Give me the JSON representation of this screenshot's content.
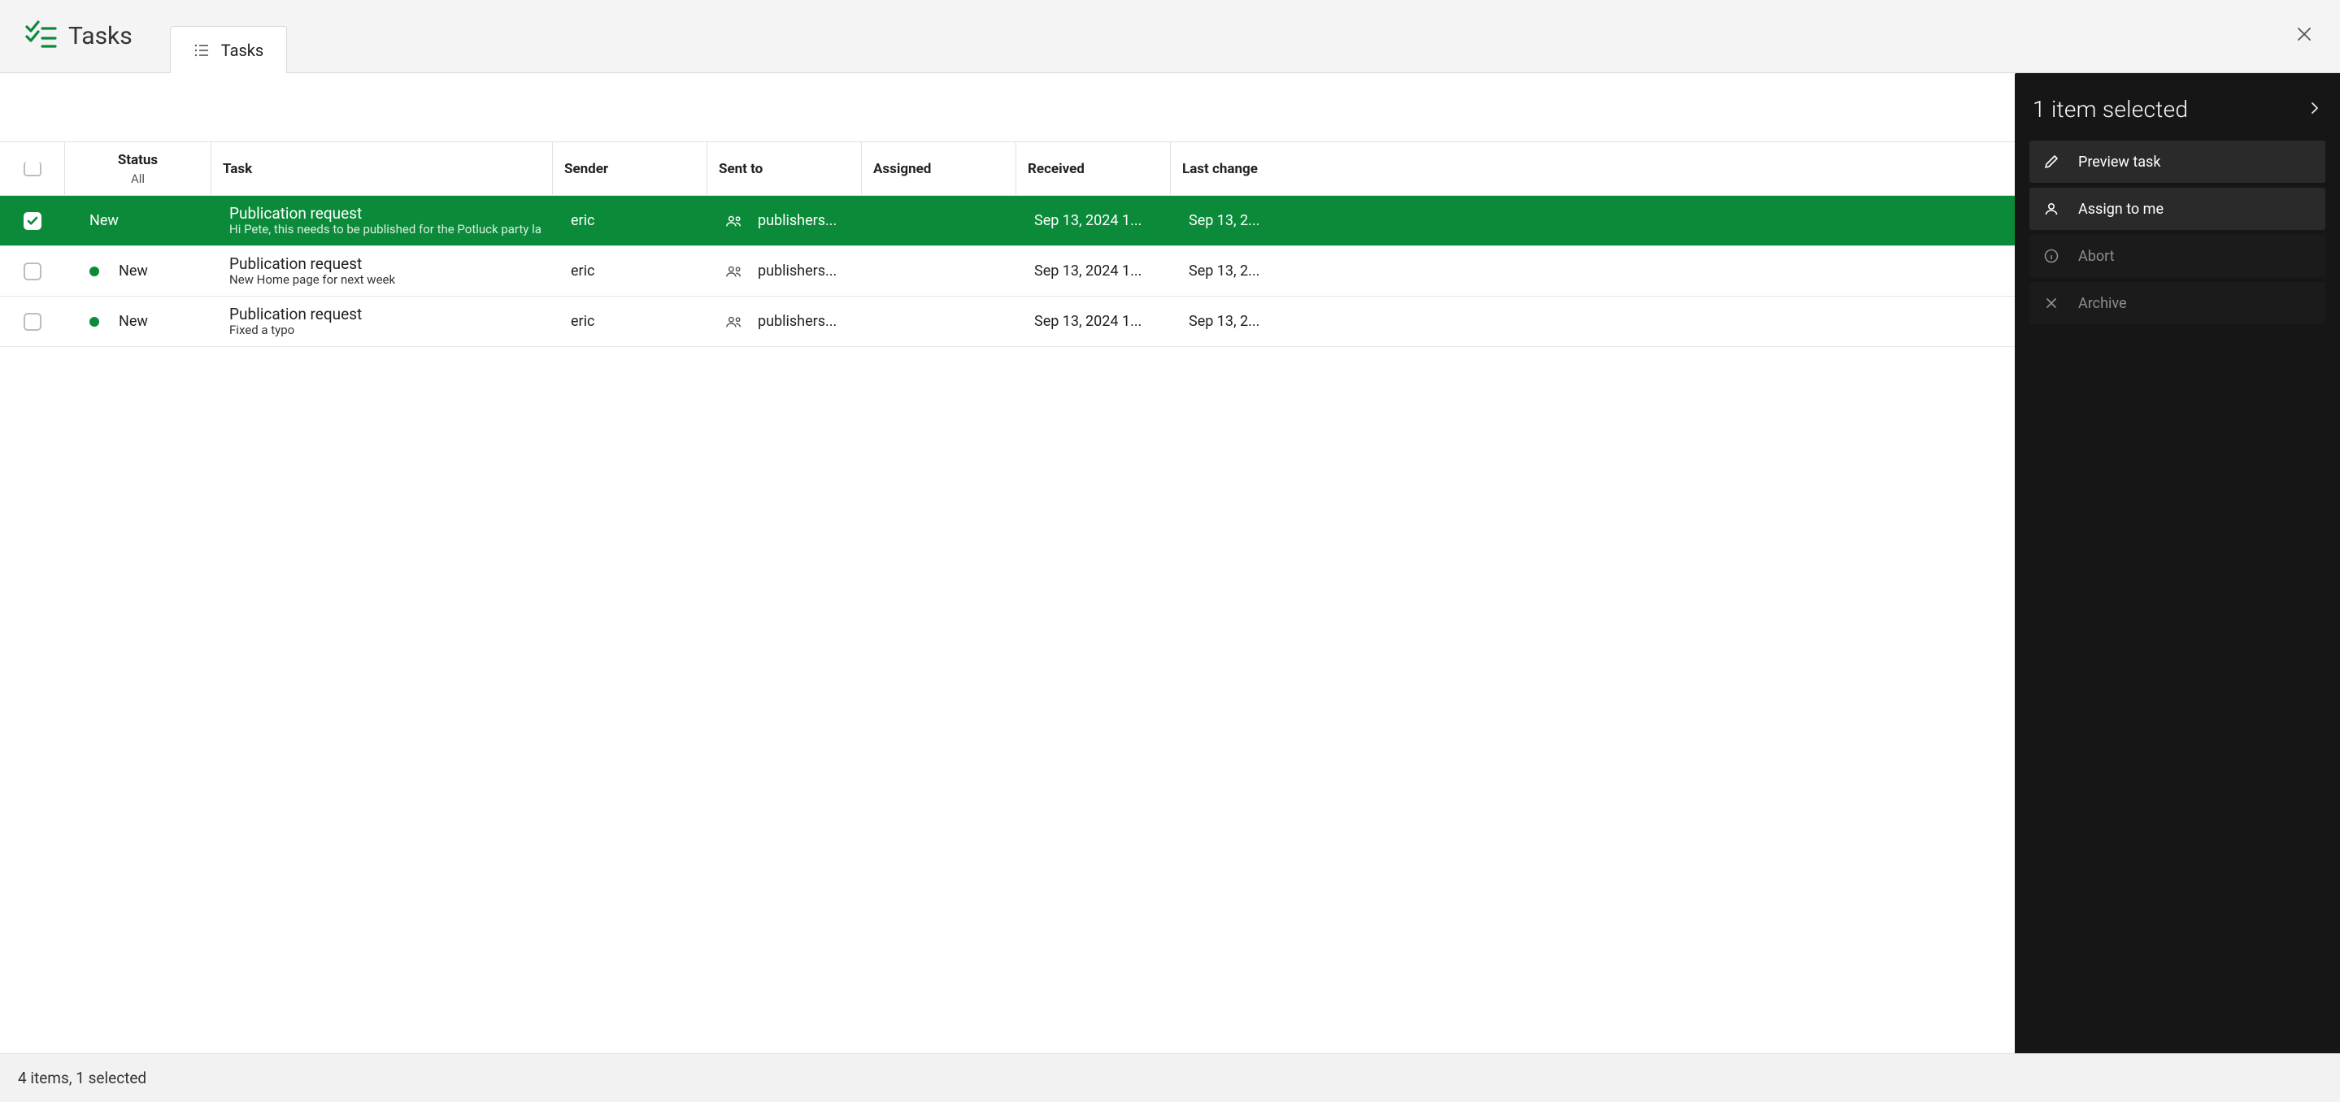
{
  "header": {
    "title": "Tasks",
    "tab_label": "Tasks"
  },
  "columns": {
    "status": "Status",
    "status_sub": "All",
    "task": "Task",
    "sender": "Sender",
    "sent_to": "Sent to",
    "assigned": "Assigned",
    "received": "Received",
    "last_change": "Last change"
  },
  "rows": [
    {
      "selected": true,
      "status": "New",
      "title": "Publication request",
      "subtitle": "Hi Pete, this needs to be published for the Potluck party la",
      "sender": "eric",
      "sent_to": "publishers...",
      "assigned": "",
      "received": "Sep 13, 2024 1...",
      "last_change": "Sep 13, 2..."
    },
    {
      "selected": false,
      "status": "New",
      "title": "Publication request",
      "subtitle": "New Home page for next week",
      "sender": "eric",
      "sent_to": "publishers...",
      "assigned": "",
      "received": "Sep 13, 2024 1...",
      "last_change": "Sep 13, 2..."
    },
    {
      "selected": false,
      "status": "New",
      "title": "Publication request",
      "subtitle": "Fixed a typo",
      "sender": "eric",
      "sent_to": "publishers...",
      "assigned": "",
      "received": "Sep 13, 2024 1...",
      "last_change": "Sep 13, 2..."
    }
  ],
  "side": {
    "title": "1 item selected",
    "actions": {
      "preview": "Preview task",
      "assign": "Assign to me",
      "abort": "Abort",
      "archive": "Archive"
    }
  },
  "status": "4 items, 1 selected"
}
